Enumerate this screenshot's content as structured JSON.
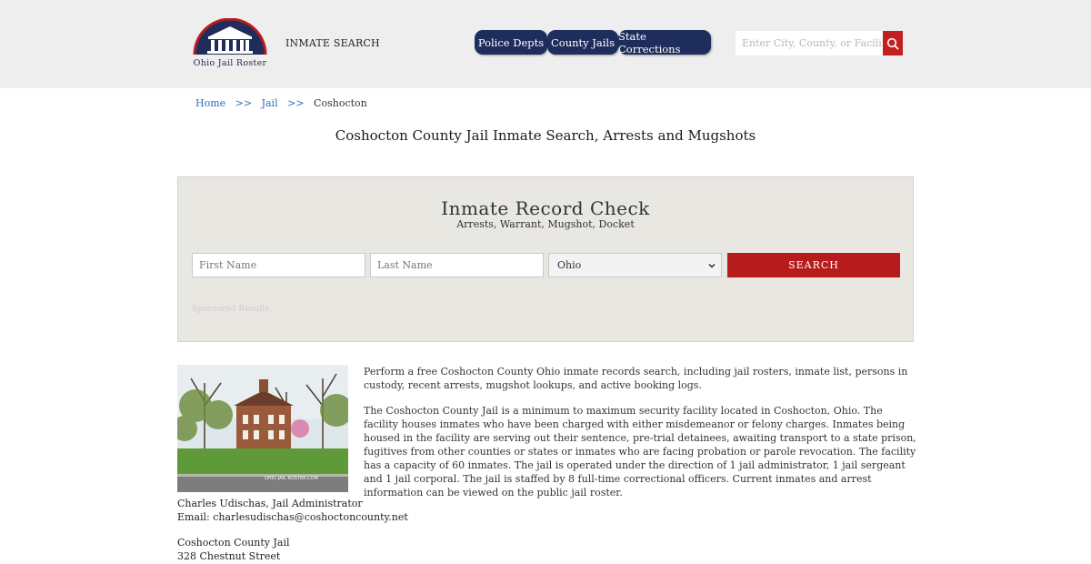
{
  "header": {
    "logo_text": "Ohio Jail Roster",
    "inmate_search_label": "INMATE SEARCH",
    "nav_tabs": [
      "Police Depts",
      "County Jails",
      "State Corrections"
    ],
    "search_placeholder": "Enter City, County, or Facility"
  },
  "breadcrumb": {
    "home": "Home",
    "separator": ">>",
    "jail": "Jail",
    "current": "Coshocton"
  },
  "page_title": "Coshocton County Jail Inmate Search, Arrests and Mugshots",
  "record_check": {
    "title": "Inmate Record Check",
    "subtitle": "Arrests, Warrant, Mugshot, Docket",
    "first_name_placeholder": "First Name",
    "last_name_placeholder": "Last Name",
    "state_selected": "Ohio",
    "search_button": "SEARCH",
    "sponsored": "Sponsored Results"
  },
  "content": {
    "photo_watermark": "OHIO JAIL ROSTER.COM",
    "admin_line": "Charles Udischas, Jail Administrator",
    "email_line": "Email: charlesudischas@coshoctoncounty.net",
    "facility_name": "Coshocton County Jail",
    "street": "328 Chestnut Street",
    "paragraph1": "Perform a free Coshocton County Ohio inmate records search, including jail rosters, inmate list, persons in custody, recent arrests, mugshot lookups, and active booking logs.",
    "paragraph2": "The Coshocton County Jail is a minimum to maximum security facility located in Coshocton, Ohio. The facility houses inmates who have been charged with either misdemeanor or felony charges. Inmates being housed in the facility are serving out their sentence, pre-trial detainees, awaiting transport to a state prison, fugitives from other counties or states or inmates who are facing probation or parole revocation. The facility has a capacity of 60 inmates. The jail is operated under the direction of 1 jail administrator, 1 jail sergeant and 1 jail corporal. The jail is staffed by 8 full-time correctional officers. Current inmates and arrest information can be viewed on the public jail roster."
  },
  "colors": {
    "nav_tab": "#1f2d5c",
    "accent_red": "#b71c1c",
    "link_blue": "#2a6ebb",
    "panel_bg": "#e9e7e2"
  }
}
